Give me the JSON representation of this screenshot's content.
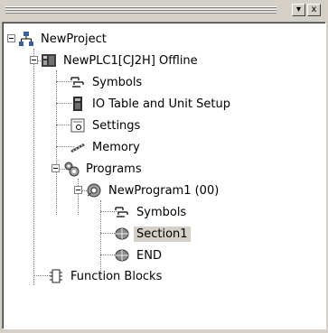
{
  "titlebar": {
    "minimize_glyph": "▾",
    "close_glyph": "x"
  },
  "tree": [
    {
      "label": "NewProject",
      "icon": "network-icon"
    },
    {
      "label": "NewPLC1[CJ2H] Offline",
      "icon": "plc-icon"
    },
    {
      "label": "Symbols",
      "icon": "symbols-icon"
    },
    {
      "label": "IO Table and Unit Setup",
      "icon": "io-table-icon"
    },
    {
      "label": "Settings",
      "icon": "settings-icon"
    },
    {
      "label": "Memory",
      "icon": "memory-icon"
    },
    {
      "label": "Programs",
      "icon": "programs-icon"
    },
    {
      "label": "NewProgram1 (00)",
      "icon": "program-icon"
    },
    {
      "label": "Symbols",
      "icon": "symbols-icon"
    },
    {
      "label": "Section1",
      "icon": "section-icon",
      "selected": true
    },
    {
      "label": "END",
      "icon": "section-icon"
    },
    {
      "label": "Function Blocks",
      "icon": "function-blocks-icon"
    }
  ]
}
